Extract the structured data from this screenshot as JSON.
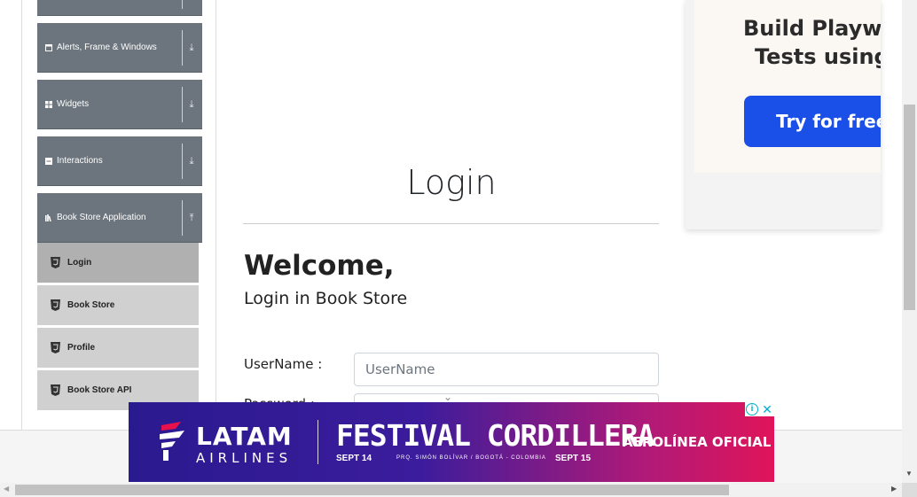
{
  "sidebar": {
    "groups": [
      {
        "label": "",
        "icon": "collapsed-group-icon"
      },
      {
        "label": "Alerts, Frame & Windows",
        "icon": "window-icon"
      },
      {
        "label": "Widgets",
        "icon": "grid-icon"
      },
      {
        "label": "Interactions",
        "icon": "list-icon"
      },
      {
        "label": "Book Store Application",
        "icon": "books-icon"
      }
    ],
    "items": [
      {
        "label": "Login",
        "icon": "html5-icon"
      },
      {
        "label": "Book Store",
        "icon": "html5-icon"
      },
      {
        "label": "Profile",
        "icon": "html5-icon"
      },
      {
        "label": "Book Store API",
        "icon": "html5-icon"
      }
    ],
    "expand_arrow": "⤓",
    "collapse_arrow": "⤒"
  },
  "main": {
    "title": "Login",
    "welcome": "Welcome,",
    "subheading": "Login in Book Store",
    "username_label": "UserName :",
    "username_placeholder": "UserName",
    "password_label": "Password :"
  },
  "ad_top": {
    "line1": "Build Playwrigh",
    "line2": "Tests using A",
    "button_label": "Try for free →",
    "button_color": "#1a4fe8"
  },
  "ad_bottom": {
    "brand": "LATAM",
    "brand_sub": "AIRLINES",
    "event": "FESTIVAL CORDILLERA",
    "date_start": "SEPT 14",
    "venue": "PRQ. SIMÓN BOLÍVAR / BOGOTÁ - COLOMBIA",
    "date_end": "SEPT 15",
    "tagline": "AEROLÍNEA OFICIAL",
    "info_icon": "i",
    "close_icon": "✕"
  },
  "colors": {
    "sidebar_group": "#6c757d",
    "sidebar_item": "#d0d0d0",
    "sidebar_item_active": "#b0b0b0"
  }
}
